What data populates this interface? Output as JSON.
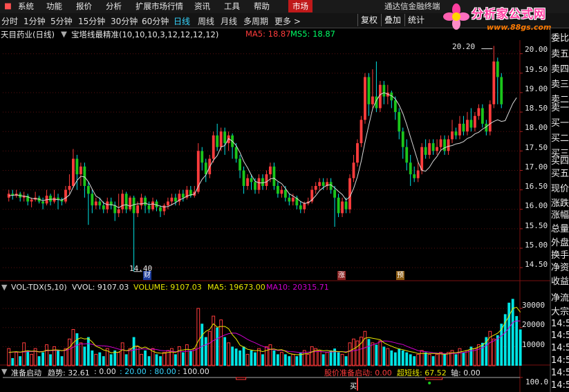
{
  "menu": {
    "items": [
      "系统",
      "功能",
      "报价",
      "分析",
      "扩展市场行情",
      "资讯",
      "工具",
      "帮助"
    ],
    "market": "市场",
    "brand": "通达信金融终端"
  },
  "logo": {
    "title": "分析家公式网",
    "url": "www.88gs.com"
  },
  "periods": [
    "分时",
    "1分钟",
    "5分钟",
    "15分钟",
    "30分钟",
    "60分钟",
    "日线",
    "周线",
    "月线",
    "多周期",
    "更多 >"
  ],
  "active_period": "日线",
  "toolbar_buttons": [
    "复权",
    "叠加",
    "统计"
  ],
  "chart_header": {
    "stock": "天目药业(日线)",
    "indicator": "宝塔线最精准(10,10,10,3,12,12,12,12)",
    "ma5": "MA5: 18.87",
    "ms5": "MS5: 18.87"
  },
  "price_axis": [
    "20.00",
    "19.50",
    "19.00",
    "18.50",
    "18.00",
    "17.50",
    "17.00",
    "16.50",
    "16.00",
    "15.50",
    "15.00",
    "14.50"
  ],
  "annotations": {
    "high": "20.20",
    "low": "14.40"
  },
  "badges": [
    "财",
    "涨",
    "预"
  ],
  "volume_header": {
    "name": "VOL-TDX(5,10)",
    "vvol": "VVOL: 9107.03",
    "volume": "VOLUME: 9107.03",
    "ma5": "MA5: 19673.00",
    "ma10": "MA10: 20315.71"
  },
  "volume_axis": [
    "30000",
    "20000",
    "10000"
  ],
  "indicator_header": {
    "name": "准备启动",
    "trend": "趋势: 32.61",
    "v1": ": 0.00",
    "v2": ": 20.00",
    "v3": ": 80.00",
    "v4": ": 100.00",
    "start": "股价准备启动: 0.00",
    "super": "超短线: 67.52",
    "axis": "轴: 0.00"
  },
  "indicator_axis": [
    "100.0"
  ],
  "buy_label": "买",
  "side_panel": [
    "委比",
    "卖五",
    "卖四",
    "卖三",
    "卖二",
    "卖一",
    "买一",
    "买二",
    "买三",
    "买四",
    "买五",
    "现价",
    "涨跌",
    "涨幅",
    "总量",
    "外盘",
    "换手",
    "净资",
    "收益",
    "净流",
    "大宗",
    "14:5",
    "14:5",
    "14:5",
    "14:5",
    "14:5",
    "14:5"
  ],
  "colors": {
    "up": "#ff3c3c",
    "down": "#00e5e5",
    "down_candle": "#1bc61b",
    "ma": "#e8e800",
    "ma10": "#d000d0",
    "axis": "#e8e8e8"
  },
  "chart_data": {
    "type": "candlestick",
    "ylim": [
      14.2,
      20.35
    ],
    "candles": [
      [
        16.3,
        16.4,
        16.5,
        16.2
      ],
      [
        16.4,
        16.35,
        16.5,
        16.25
      ],
      [
        16.35,
        16.4,
        16.5,
        16.3
      ],
      [
        16.4,
        16.3,
        16.45,
        16.2
      ],
      [
        16.3,
        16.35,
        16.45,
        16.2
      ],
      [
        16.35,
        16.2,
        16.4,
        16.1
      ],
      [
        16.2,
        16.25,
        16.3,
        16.05
      ],
      [
        16.25,
        16.3,
        16.45,
        16.2
      ],
      [
        16.3,
        16.2,
        16.35,
        16.15
      ],
      [
        16.2,
        16.15,
        16.3,
        16.0
      ],
      [
        16.15,
        16.35,
        16.5,
        16.1
      ],
      [
        16.35,
        16.2,
        16.4,
        16.1
      ],
      [
        16.2,
        16.3,
        16.5,
        16.15
      ],
      [
        16.3,
        16.25,
        16.4,
        16.0
      ],
      [
        16.25,
        16.2,
        16.3,
        16.1
      ],
      [
        16.2,
        16.5,
        16.6,
        16.15
      ],
      [
        16.5,
        16.6,
        16.9,
        16.4
      ],
      [
        16.6,
        17.3,
        17.55,
        16.55
      ],
      [
        17.3,
        16.9,
        17.4,
        16.5
      ],
      [
        16.9,
        17.1,
        17.2,
        16.6
      ],
      [
        17.1,
        16.6,
        17.2,
        16.3
      ],
      [
        16.6,
        16.4,
        16.7,
        15.6
      ],
      [
        16.4,
        16.1,
        16.5,
        15.9
      ],
      [
        16.1,
        16.2,
        16.3,
        16.0
      ],
      [
        16.2,
        16.1,
        16.3,
        16.0
      ],
      [
        16.1,
        16.0,
        16.2,
        15.9
      ],
      [
        16.0,
        16.2,
        16.3,
        15.9
      ],
      [
        16.2,
        16.1,
        16.3,
        16.0
      ],
      [
        16.1,
        15.9,
        16.2,
        15.7
      ],
      [
        15.9,
        16.0,
        16.4,
        15.8
      ],
      [
        16.0,
        16.4,
        16.5,
        15.9
      ],
      [
        16.4,
        16.0,
        16.45,
        15.9
      ],
      [
        16.0,
        16.3,
        16.35,
        15.95
      ],
      [
        16.3,
        15.9,
        16.35,
        14.4
      ],
      [
        15.9,
        16.1,
        16.2,
        15.8
      ],
      [
        16.1,
        16.3,
        16.4,
        16.0
      ],
      [
        16.3,
        16.1,
        16.35,
        15.9
      ],
      [
        16.1,
        16.0,
        16.2,
        15.9
      ],
      [
        16.0,
        16.2,
        16.3,
        15.95
      ],
      [
        16.2,
        16.05,
        16.25,
        15.95
      ],
      [
        16.05,
        15.95,
        16.1,
        15.8
      ],
      [
        15.95,
        16.1,
        16.15,
        15.85
      ],
      [
        16.1,
        16.2,
        16.3,
        16.0
      ],
      [
        16.2,
        16.3,
        16.4,
        16.1
      ],
      [
        16.3,
        16.2,
        16.4,
        16.1
      ],
      [
        16.2,
        16.4,
        16.5,
        16.1
      ],
      [
        16.4,
        16.3,
        16.5,
        16.2
      ],
      [
        16.3,
        16.5,
        16.6,
        16.25
      ],
      [
        16.5,
        16.35,
        16.6,
        16.3
      ],
      [
        16.35,
        16.45,
        16.6,
        16.3
      ],
      [
        16.45,
        17.5,
        17.7,
        16.4
      ],
      [
        17.5,
        17.2,
        17.6,
        17.0
      ],
      [
        17.2,
        16.9,
        17.3,
        16.7
      ],
      [
        16.9,
        17.3,
        17.4,
        16.8
      ],
      [
        17.3,
        17.9,
        18.0,
        17.2
      ],
      [
        17.9,
        17.6,
        18.2,
        17.5
      ],
      [
        17.6,
        18.0,
        18.1,
        17.5
      ],
      [
        18.0,
        17.7,
        18.1,
        17.4
      ],
      [
        17.7,
        17.9,
        18.0,
        17.5
      ],
      [
        17.9,
        17.6,
        17.95,
        17.3
      ],
      [
        17.6,
        17.3,
        17.7,
        17.2
      ],
      [
        17.3,
        17.0,
        17.4,
        16.8
      ],
      [
        17.0,
        16.6,
        17.1,
        16.4
      ],
      [
        16.6,
        16.8,
        16.9,
        16.5
      ],
      [
        16.8,
        16.7,
        16.9,
        16.5
      ],
      [
        16.7,
        16.5,
        16.8,
        16.4
      ],
      [
        16.5,
        16.8,
        16.9,
        16.4
      ],
      [
        16.8,
        16.6,
        16.9,
        16.5
      ],
      [
        16.6,
        16.9,
        17.0,
        16.5
      ],
      [
        16.9,
        17.1,
        17.2,
        16.7
      ],
      [
        17.1,
        16.6,
        17.2,
        16.5
      ],
      [
        16.6,
        16.4,
        16.7,
        16.3
      ],
      [
        16.4,
        16.5,
        16.6,
        16.3
      ],
      [
        16.5,
        16.3,
        16.6,
        16.2
      ],
      [
        16.3,
        16.2,
        16.4,
        16.1
      ],
      [
        16.2,
        16.3,
        16.4,
        16.1
      ],
      [
        16.3,
        16.1,
        16.35,
        16.0
      ],
      [
        16.1,
        16.0,
        16.2,
        15.9
      ],
      [
        16.0,
        16.15,
        16.2,
        15.9
      ],
      [
        16.15,
        16.2,
        16.3,
        16.1
      ],
      [
        16.2,
        16.5,
        16.6,
        16.15
      ],
      [
        16.5,
        16.6,
        16.7,
        16.4
      ],
      [
        16.6,
        16.7,
        16.8,
        16.5
      ],
      [
        16.7,
        16.6,
        16.8,
        16.5
      ],
      [
        16.6,
        16.7,
        16.8,
        16.5
      ],
      [
        16.7,
        16.5,
        16.8,
        16.4
      ],
      [
        16.5,
        16.3,
        16.6,
        15.55
      ],
      [
        16.3,
        15.9,
        16.4,
        15.8
      ],
      [
        15.9,
        16.2,
        16.3,
        15.8
      ],
      [
        16.2,
        16.0,
        16.3,
        15.9
      ],
      [
        16.0,
        16.8,
        16.9,
        15.9
      ],
      [
        16.8,
        17.2,
        17.4,
        16.7
      ],
      [
        17.2,
        17.7,
        17.8,
        17.1
      ],
      [
        17.7,
        18.3,
        18.4,
        17.6
      ],
      [
        18.3,
        19.4,
        19.5,
        18.2
      ],
      [
        19.4,
        18.7,
        19.5,
        18.4
      ],
      [
        18.7,
        18.9,
        19.6,
        18.6
      ],
      [
        18.9,
        18.6,
        19.8,
        18.5
      ],
      [
        18.6,
        19.2,
        19.3,
        18.5
      ],
      [
        19.2,
        18.9,
        19.3,
        18.7
      ],
      [
        18.9,
        19.0,
        19.2,
        18.7
      ],
      [
        19.0,
        18.8,
        19.05,
        18.6
      ],
      [
        18.8,
        18.5,
        18.9,
        18.3
      ],
      [
        18.5,
        18.0,
        18.6,
        17.8
      ],
      [
        18.0,
        17.6,
        18.1,
        17.3
      ],
      [
        17.6,
        17.2,
        17.8,
        17.0
      ],
      [
        17.2,
        16.9,
        17.4,
        16.6
      ],
      [
        16.9,
        16.8,
        17.1,
        16.7
      ],
      [
        16.8,
        17.0,
        17.2,
        16.7
      ],
      [
        17.0,
        17.6,
        17.7,
        16.9
      ],
      [
        17.6,
        17.4,
        17.8,
        17.3
      ],
      [
        17.4,
        17.7,
        17.8,
        17.3
      ],
      [
        17.7,
        17.5,
        17.8,
        17.4
      ],
      [
        17.5,
        17.6,
        17.8,
        17.4
      ],
      [
        17.6,
        17.8,
        17.9,
        17.5
      ],
      [
        17.8,
        17.5,
        17.9,
        17.4
      ],
      [
        17.5,
        17.8,
        17.9,
        17.4
      ],
      [
        17.8,
        18.0,
        18.3,
        17.7
      ],
      [
        18.0,
        17.9,
        18.1,
        17.8
      ],
      [
        17.9,
        18.2,
        18.4,
        17.8
      ],
      [
        18.2,
        18.0,
        18.4,
        17.9
      ],
      [
        18.0,
        18.3,
        18.5,
        17.9
      ],
      [
        18.3,
        18.1,
        18.6,
        18.0
      ],
      [
        18.1,
        18.4,
        18.5,
        18.0
      ],
      [
        18.4,
        18.6,
        18.7,
        18.3
      ],
      [
        18.6,
        18.2,
        18.7,
        18.1
      ],
      [
        18.2,
        18.0,
        18.3,
        17.9
      ],
      [
        18.0,
        18.7,
        18.8,
        17.9
      ],
      [
        18.7,
        19.8,
        20.2,
        18.6
      ],
      [
        19.8,
        19.4,
        19.9,
        18.7
      ],
      [
        19.4,
        18.7,
        19.5,
        18.6
      ]
    ],
    "ma_line": [
      16.35,
      16.36,
      16.37,
      16.35,
      16.34,
      16.32,
      16.28,
      16.27,
      16.26,
      16.22,
      16.25,
      16.26,
      16.26,
      16.25,
      16.24,
      16.29,
      16.37,
      16.57,
      16.74,
      16.85,
      16.83,
      16.71,
      16.52,
      16.34,
      16.28,
      16.16,
      16.12,
      16.12,
      16.1,
      16.04,
      16.1,
      16.12,
      16.08,
      16.12,
      16.14,
      16.14,
      16.16,
      16.12,
      16.14,
      16.11,
      16.08,
      16.06,
      16.07,
      16.12,
      16.17,
      16.24,
      16.28,
      16.34,
      16.37,
      16.39,
      16.59,
      16.77,
      16.88,
      17.09,
      17.26,
      17.38,
      17.6,
      17.64,
      17.82,
      17.75,
      17.64,
      17.46,
      17.23,
      17.07,
      16.88,
      16.72,
      16.68,
      16.68,
      16.7,
      16.78,
      16.8,
      16.72,
      16.66,
      16.54,
      16.4,
      16.34,
      16.28,
      16.2,
      16.15,
      16.17,
      16.24,
      16.35,
      16.48,
      16.56,
      16.62,
      16.63,
      16.55,
      16.46,
      16.38,
      16.24,
      16.32,
      16.54,
      16.84,
      17.24,
      17.72,
      18.16,
      18.58,
      18.8,
      18.95,
      19.0,
      18.96,
      18.92,
      18.84,
      18.68,
      18.46,
      18.18,
      17.86,
      17.54,
      17.22,
      17.0,
      16.98,
      17.08,
      17.24,
      17.36,
      17.52,
      17.58,
      17.62,
      17.64,
      17.68,
      17.7,
      17.74,
      17.82,
      17.86,
      17.94,
      17.98,
      18.06,
      18.12,
      18.2,
      18.26,
      18.3,
      18.26,
      18.28,
      18.5,
      18.72,
      18.87
    ],
    "volume": {
      "ylim": [
        0,
        38000
      ],
      "values": [
        9000,
        4000,
        7000,
        5000,
        12000,
        8000,
        6000,
        9000,
        5000,
        7000,
        11000,
        6000,
        10000,
        8000,
        5000,
        9000,
        14000,
        19000,
        17000,
        12000,
        10000,
        15000,
        8000,
        6000,
        7000,
        5000,
        9000,
        6000,
        8000,
        7000,
        12000,
        6000,
        9000,
        15000,
        10000,
        6000,
        8000,
        5000,
        9000,
        6000,
        5000,
        7000,
        8000,
        9000,
        6000,
        10000,
        7000,
        11000,
        8000,
        9000,
        30000,
        22000,
        15000,
        18000,
        26000,
        20000,
        24000,
        15000,
        12000,
        10000,
        9000,
        8000,
        10000,
        6000,
        8000,
        7000,
        9000,
        6000,
        10000,
        11000,
        8000,
        6000,
        7000,
        6000,
        5000,
        6000,
        5000,
        7000,
        8000,
        6000,
        10000,
        9000,
        8000,
        6000,
        7000,
        8000,
        9000,
        7000,
        6000,
        5000,
        12000,
        14000,
        13000,
        15000,
        18000,
        14000,
        12000,
        11000,
        13000,
        10000,
        9000,
        8000,
        7000,
        9000,
        8000,
        7000,
        6000,
        5000,
        6000,
        8000,
        7000,
        6000,
        5000,
        6000,
        7000,
        6000,
        7000,
        8000,
        6000,
        9000,
        7000,
        8000,
        10000,
        9000,
        11000,
        12000,
        15000,
        18000,
        14000,
        16000,
        22000,
        27000,
        33000,
        35000,
        26000,
        19000
      ],
      "ma5": [
        7000,
        7200,
        7400,
        7100,
        7500,
        7800,
        7600,
        7700,
        7200,
        7400,
        8100,
        8000,
        8300,
        8200,
        7900,
        8300,
        9600,
        12000,
        13800,
        14600,
        14000,
        14200,
        12500,
        10200,
        9400,
        8200,
        7800,
        6800,
        7000,
        7100,
        8400,
        7800,
        8400,
        10000,
        10400,
        9200,
        9800,
        8800,
        7600,
        6800,
        6600,
        6500,
        7000,
        7200,
        7000,
        8000,
        8200,
        8600,
        8400,
        9000,
        13000,
        16000,
        18000,
        19000,
        22000,
        20200,
        20600,
        20600,
        19400,
        16200,
        14000,
        10800,
        9800,
        8600,
        8200,
        7800,
        8000,
        7400,
        8000,
        8600,
        8800,
        8200,
        8400,
        7600,
        6400,
        6000,
        5800,
        5800,
        6200,
        6400,
        7200,
        8000,
        8200,
        7800,
        8000,
        7600,
        7600,
        7400,
        7400,
        7000,
        7800,
        8800,
        10000,
        11800,
        14400,
        14800,
        14400,
        14000,
        13600,
        12000,
        11000,
        10200,
        9400,
        8800,
        8400,
        7800,
        7400,
        7000,
        6400,
        6400,
        6400,
        6400,
        6400,
        6400,
        6200,
        6000,
        6200,
        6800,
        6800,
        7200,
        7600,
        8000,
        8800,
        9000,
        9800,
        10800,
        12400,
        15000,
        16000,
        17000,
        19000,
        22600,
        26000,
        30000,
        30600,
        28000
      ],
      "ma10": [
        7000,
        7100,
        7200,
        7100,
        7200,
        7400,
        7400,
        7500,
        7400,
        7500,
        7800,
        7900,
        8000,
        8000,
        7900,
        8000,
        8600,
        9700,
        10800,
        11400,
        11400,
        11600,
        11200,
        10600,
        10500,
        10400,
        10200,
        9800,
        9300,
        8700,
        8300,
        7900,
        7800,
        8200,
        8600,
        8800,
        8800,
        8600,
        8700,
        8500,
        8000,
        7900,
        7800,
        7600,
        7400,
        7300,
        7400,
        7600,
        7700,
        8100,
        9000,
        10200,
        11000,
        11800,
        13200,
        14200,
        15200,
        16100,
        16800,
        17100,
        17000,
        16100,
        15000,
        13800,
        12800,
        12000,
        11000,
        10200,
        9500,
        8600,
        8400,
        8000,
        8000,
        7800,
        7400,
        7300,
        7100,
        6800,
        6900,
        7100,
        7300,
        7400,
        7500,
        7200,
        7100,
        7200,
        7300,
        7400,
        7300,
        7300,
        7500,
        7900,
        8200,
        8800,
        9400,
        10200,
        10900,
        11600,
        12500,
        13000,
        12900,
        12500,
        12000,
        11500,
        11100,
        10200,
        9400,
        8700,
        7900,
        7600,
        7400,
        7100,
        6800,
        6600,
        6500,
        6400,
        6300,
        6400,
        6500,
        6700,
        6900,
        7200,
        7800,
        8000,
        8700,
        9400,
        10600,
        12100,
        13000,
        14200,
        15600,
        17400,
        19800,
        22700,
        23500,
        23400
      ]
    },
    "indicator": {
      "ylim": [
        0,
        105
      ],
      "trend": 32.61,
      "super_short": 67.52,
      "levels": [
        0,
        20,
        80,
        100
      ]
    }
  }
}
